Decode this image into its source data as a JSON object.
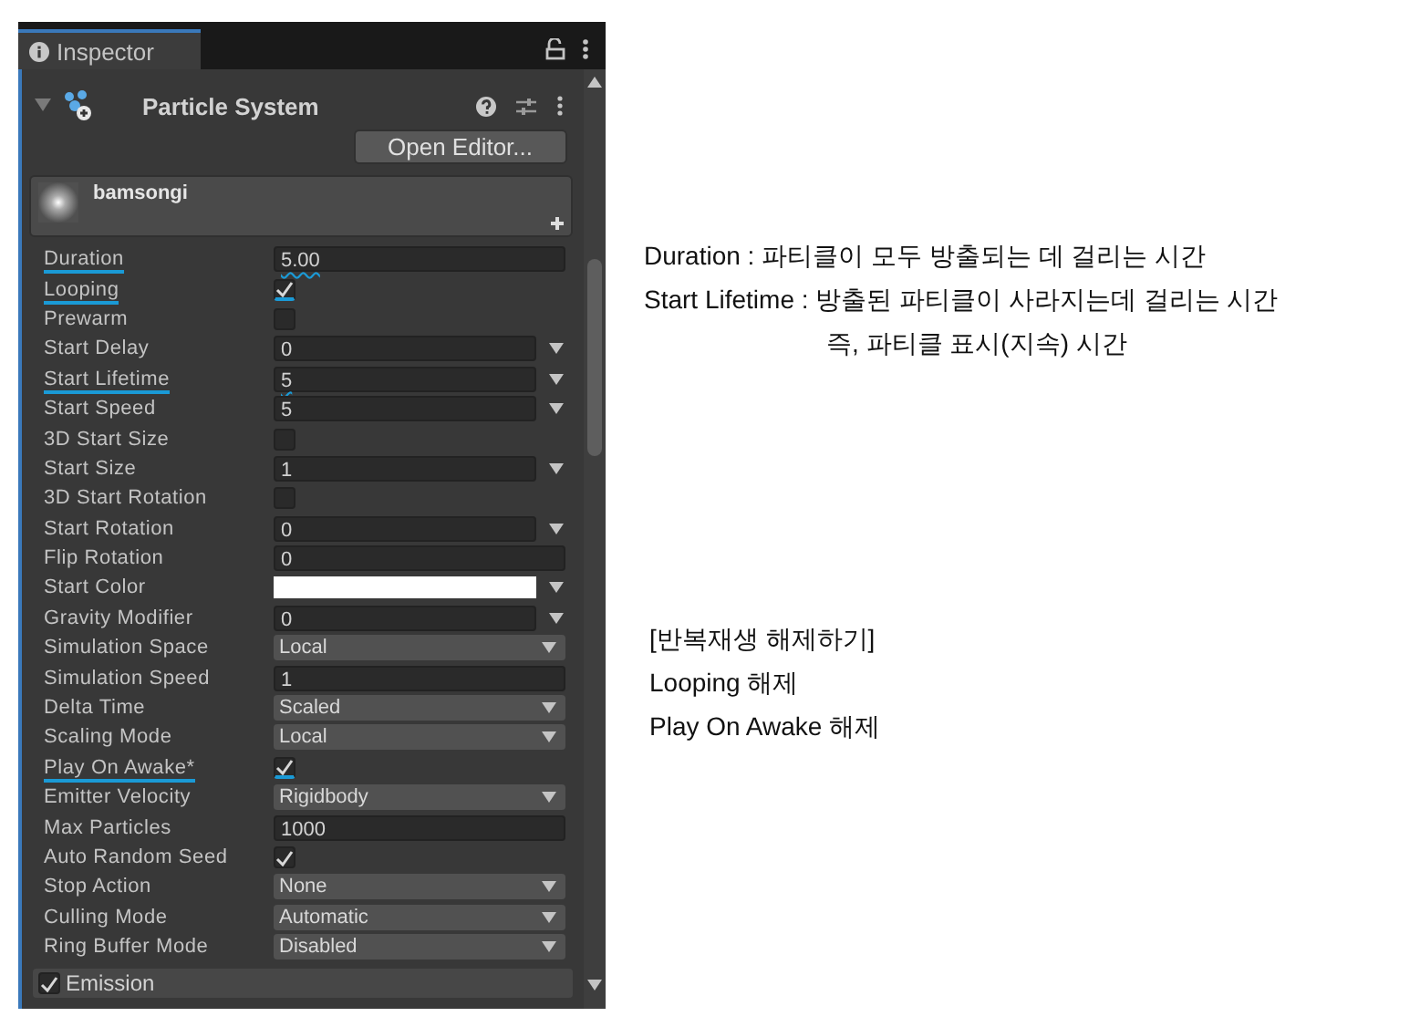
{
  "tab": {
    "title": "Inspector",
    "selected": true
  },
  "component": {
    "title": "Particle System",
    "expanded": true,
    "button": "Open Editor..."
  },
  "material": {
    "name": "bamsongi"
  },
  "rows": [
    {
      "label": "Duration",
      "kind": "field",
      "value": "5.00",
      "highlighted": true
    },
    {
      "label": "Looping",
      "kind": "check",
      "checked": true,
      "highlighted": true
    },
    {
      "label": "Prewarm",
      "kind": "check",
      "checked": false,
      "highlighted": false
    },
    {
      "label": "Start Delay",
      "kind": "curve",
      "value": "0",
      "highlighted": false
    },
    {
      "label": "Start Lifetime",
      "kind": "curve",
      "value": "5",
      "highlighted": true
    },
    {
      "label": "Start Speed",
      "kind": "curve",
      "value": "5",
      "highlighted": false
    },
    {
      "label": "3D Start Size",
      "kind": "check",
      "checked": false,
      "highlighted": false
    },
    {
      "label": "Start Size",
      "kind": "curve",
      "value": "1",
      "highlighted": false
    },
    {
      "label": "3D Start Rotation",
      "kind": "check",
      "checked": false,
      "highlighted": false
    },
    {
      "label": "Start Rotation",
      "kind": "curve",
      "value": "0",
      "highlighted": false
    },
    {
      "label": "Flip Rotation",
      "kind": "field",
      "value": "0",
      "highlighted": false
    },
    {
      "label": "Start Color",
      "kind": "color",
      "color": "#ffffff",
      "highlighted": false
    },
    {
      "label": "Gravity Modifier",
      "kind": "curve",
      "value": "0",
      "highlighted": false
    },
    {
      "label": "Simulation Space",
      "kind": "dropdown",
      "value": "Local",
      "highlighted": false
    },
    {
      "label": "Simulation Speed",
      "kind": "field",
      "value": "1",
      "highlighted": false
    },
    {
      "label": "Delta Time",
      "kind": "dropdown",
      "value": "Scaled",
      "highlighted": false
    },
    {
      "label": "Scaling Mode",
      "kind": "dropdown",
      "value": "Local",
      "highlighted": false
    },
    {
      "label": "Play On Awake*",
      "kind": "check",
      "checked": true,
      "highlighted": true
    },
    {
      "label": "Emitter Velocity",
      "kind": "dropdown",
      "value": "Rigidbody",
      "highlighted": false
    },
    {
      "label": "Max Particles",
      "kind": "field",
      "value": "1000",
      "highlighted": false
    },
    {
      "label": "Auto Random Seed",
      "kind": "check",
      "checked": true,
      "highlighted": false
    },
    {
      "label": "Stop Action",
      "kind": "dropdown",
      "value": "None",
      "highlighted": false
    },
    {
      "label": "Culling Mode",
      "kind": "dropdown",
      "value": "Automatic",
      "highlighted": false
    },
    {
      "label": "Ring Buffer Mode",
      "kind": "dropdown",
      "value": "Disabled",
      "highlighted": false
    }
  ],
  "module": {
    "label": "Emission",
    "checked": true
  },
  "notes": [
    {
      "kind": "line",
      "text": "Duration : 파티클이 모두 방출되는 데 걸리는 시간"
    },
    {
      "kind": "line",
      "text": "Start Lifetime : 방출된 파티클이 사라지는데 걸리는 시간"
    },
    {
      "kind": "continuation",
      "text": "즉, 파티클 표시(지속) 시간"
    }
  ],
  "notes2": [
    "[반복재생 해제하기]",
    "Looping 해제",
    "Play On Awake 해제"
  ]
}
